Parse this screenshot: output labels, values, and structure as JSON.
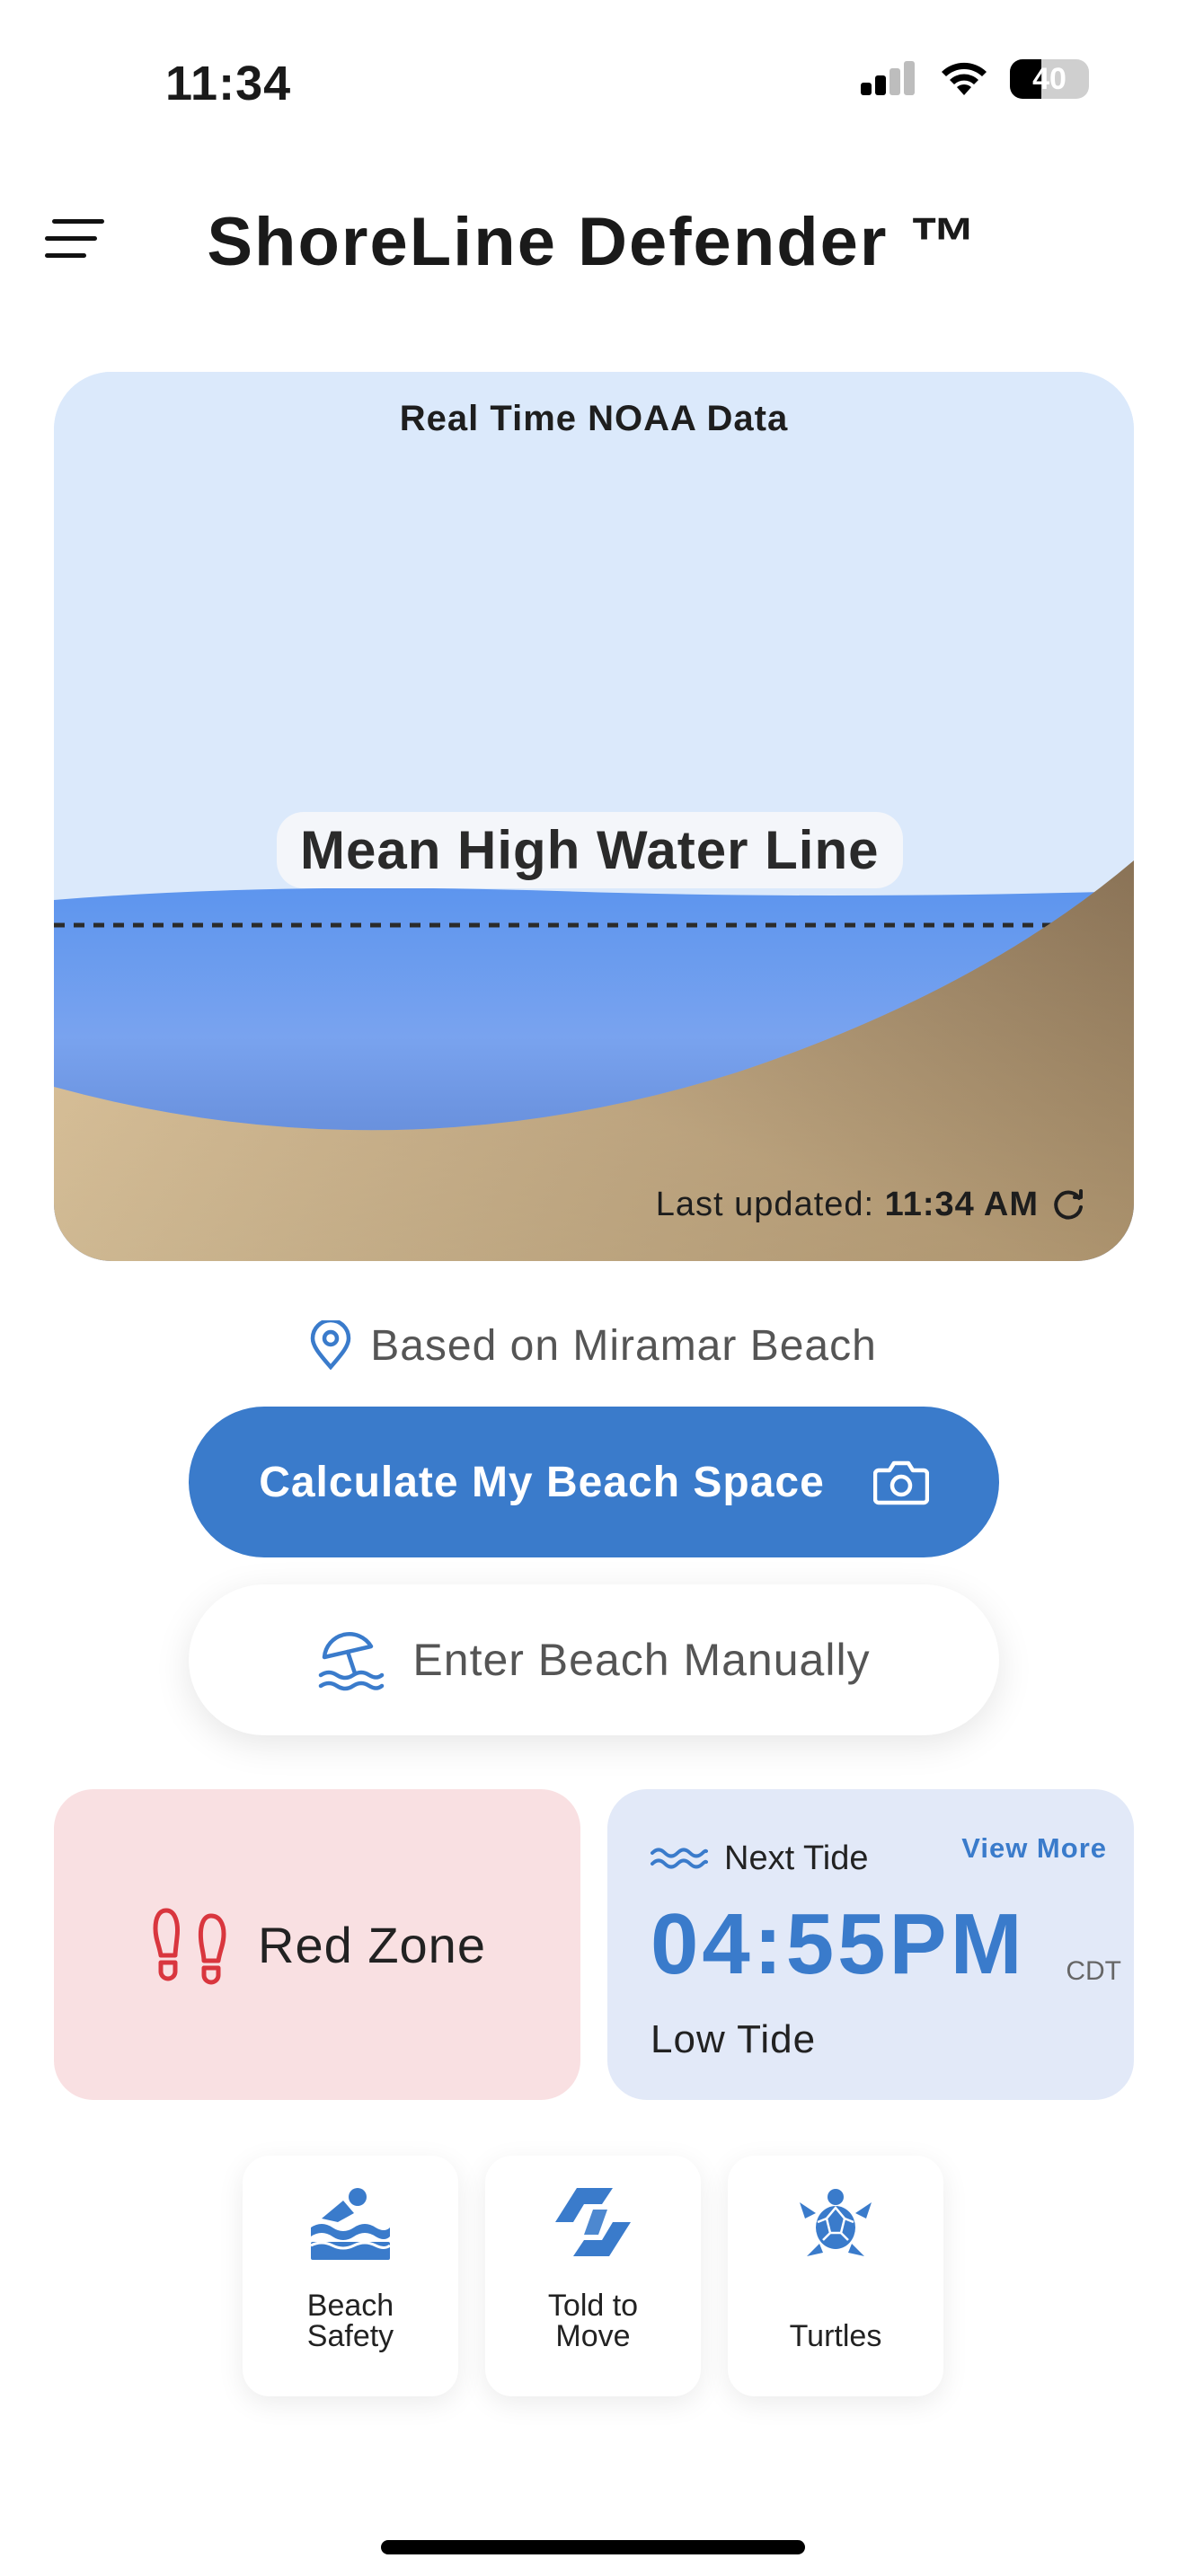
{
  "status_bar": {
    "time": "11:34",
    "battery": "40"
  },
  "header": {
    "title": "ShoreLine Defender ™"
  },
  "hero": {
    "heading": "Real Time NOAA Data",
    "line_label": "Mean High Water Line",
    "last_updated_label": "Last updated:",
    "last_updated_time": "11:34 AM"
  },
  "location": {
    "text": "Based on Miramar Beach"
  },
  "actions": {
    "calculate_label": "Calculate My Beach Space",
    "manual_label": "Enter Beach Manually"
  },
  "zone": {
    "label": "Red Zone",
    "color": "#d9363e"
  },
  "tide": {
    "heading": "Next Tide",
    "view_more": "View More",
    "time": "04:55PM",
    "timezone": "CDT",
    "type": "Low Tide"
  },
  "tiles": [
    {
      "label_line1": "Beach",
      "label_line2": "Safety",
      "icon": "swimmer-icon"
    },
    {
      "label_line1": "Told to",
      "label_line2": "Move",
      "icon": "move-icon"
    },
    {
      "label_line1": "",
      "label_line2": "Turtles",
      "icon": "turtle-icon"
    }
  ],
  "colors": {
    "accent": "#3a7bcb",
    "red_zone_bg": "#f9e0e2",
    "tide_bg": "#e2e9f8",
    "sky": "#dbe9fb"
  }
}
